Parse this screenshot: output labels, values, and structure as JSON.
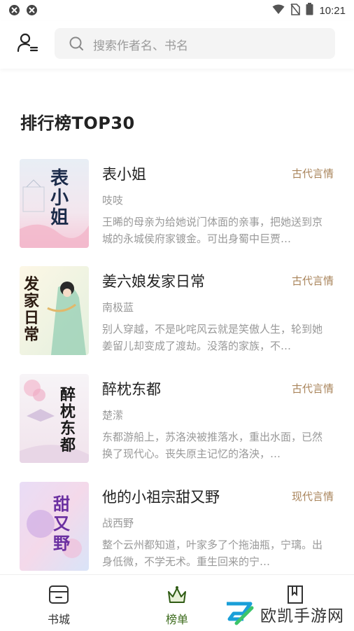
{
  "status_bar": {
    "time": "10:21"
  },
  "search": {
    "placeholder": "搜索作者名、书名"
  },
  "section": {
    "title": "排行榜TOP30"
  },
  "books": [
    {
      "title": "表小姐",
      "tag": "古代言情",
      "author": "吱吱",
      "desc": "王晞的母亲为给她说门体面的亲事，把她送到京城的永城侯府家镀金。可出身蜀中巨贾…",
      "cover_text": "表小姐"
    },
    {
      "title": "姜六娘发家日常",
      "tag": "古代言情",
      "author": "南极蓝",
      "desc": "别人穿越，不是叱咤风云就是笑傲人生，轮到她姜留儿却变成了渡劫。没落的家族，不…",
      "cover_text": "发家日常"
    },
    {
      "title": "醉枕东都",
      "tag": "古代言情",
      "author": "楚潆",
      "desc": "东都游船上，苏洛泱被推落水，重出水面，已然换了现代心。丧失原主记忆的洛泱，…",
      "cover_text": "醉枕东都"
    },
    {
      "title": "他的小祖宗甜又野",
      "tag": "现代言情",
      "author": "战西野",
      "desc": "整个云州都知道，叶家多了个拖油瓶，宁璃。出身低微，不学无术。重生回来的宁…",
      "cover_text": "甜又野"
    }
  ],
  "tabs": [
    {
      "label": "书城",
      "icon": "store-icon"
    },
    {
      "label": "榜单",
      "icon": "crown-icon"
    },
    {
      "label": "",
      "icon": "bookshelf-icon"
    }
  ],
  "watermark": {
    "text": "欧凯手游网"
  },
  "colors": {
    "accent_tag": "#a9845b",
    "active_tab": "#3c6b1c"
  }
}
